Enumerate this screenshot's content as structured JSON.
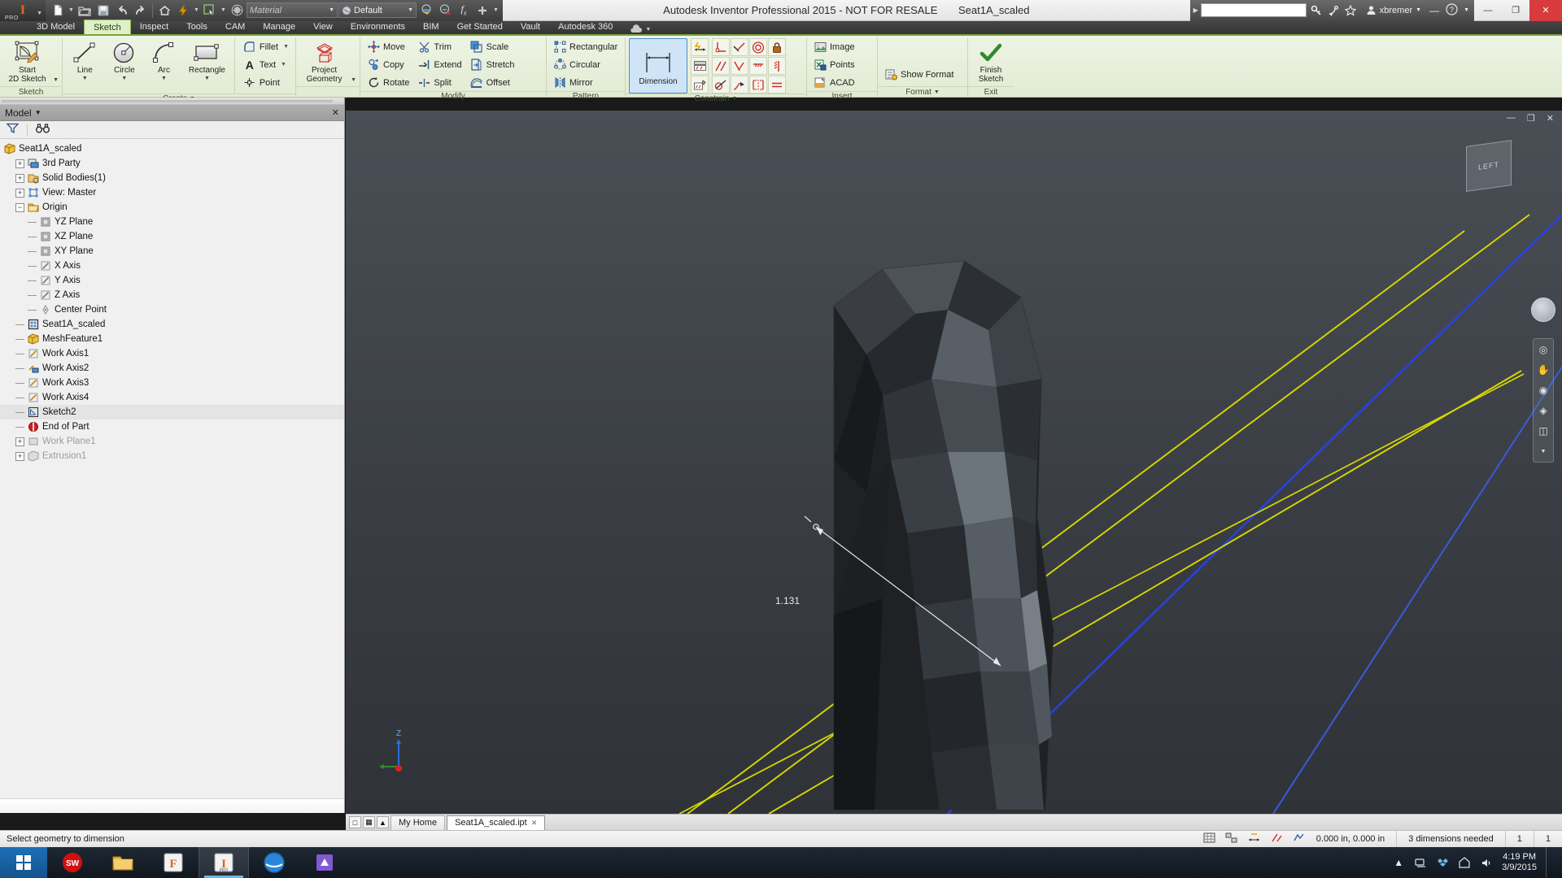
{
  "titlebar": {
    "logo_text": "I",
    "logo_sub": "PRO",
    "material_value": "Material",
    "appearance_value": "Default",
    "app_title": "Autodesk Inventor Professional 2015 - NOT FOR RESALE",
    "file_name": "Seat1A_scaled",
    "search_placeholder": "",
    "search_value": "",
    "user_name": "xbremer",
    "minimize": "—",
    "maximize": "❐",
    "close": "✕",
    "quick_access": [
      {
        "name": "new-file-icon",
        "label": "New"
      },
      {
        "name": "open-file-icon",
        "label": "Open"
      },
      {
        "name": "save-icon",
        "label": "Save"
      },
      {
        "name": "undo-icon",
        "label": "Undo"
      },
      {
        "name": "redo-icon",
        "label": "Redo"
      },
      {
        "name": "home-icon",
        "label": "Home"
      },
      {
        "name": "update-icon",
        "label": "Update"
      },
      {
        "name": "select-icon",
        "label": "Select"
      },
      {
        "name": "appearance-globe-icon",
        "label": "Appearance"
      }
    ],
    "search_icons": [
      {
        "name": "key-icon"
      },
      {
        "name": "satellite-icon"
      },
      {
        "name": "star-icon"
      }
    ],
    "user_icons": [
      {
        "name": "minimize-icon"
      },
      {
        "name": "help-icon"
      }
    ]
  },
  "tabs": [
    {
      "label": "3D Model",
      "active": false
    },
    {
      "label": "Sketch",
      "active": true
    },
    {
      "label": "Inspect",
      "active": false
    },
    {
      "label": "Tools",
      "active": false
    },
    {
      "label": "CAM",
      "active": false
    },
    {
      "label": "Manage",
      "active": false
    },
    {
      "label": "View",
      "active": false
    },
    {
      "label": "Environments",
      "active": false
    },
    {
      "label": "BIM",
      "active": false
    },
    {
      "label": "Get Started",
      "active": false
    },
    {
      "label": "Vault",
      "active": false
    },
    {
      "label": "Autodesk 360",
      "active": false
    }
  ],
  "ribbon": {
    "panels": [
      {
        "label": "Sketch",
        "big": [
          {
            "label": "Start\n2D Sketch",
            "icon": "start-2d-sketch-icon",
            "dropdown": true
          }
        ]
      },
      {
        "label": "Create",
        "label_dropdown": true,
        "big": [
          {
            "label": "Line",
            "icon": "line-icon",
            "dropdown": true
          },
          {
            "label": "Circle",
            "icon": "circle-icon",
            "dropdown": true
          },
          {
            "label": "Arc",
            "icon": "arc-icon",
            "dropdown": true
          },
          {
            "label": "Rectangle",
            "icon": "rectangle-icon",
            "dropdown": true
          }
        ],
        "small": [
          {
            "label": "Fillet",
            "icon": "fillet-icon",
            "dropdown": true
          },
          {
            "label": "Text",
            "icon": "text-icon",
            "dropdown": true
          },
          {
            "label": "Point",
            "icon": "point-icon",
            "dropdown": false
          }
        ]
      },
      {
        "label": "",
        "big": [
          {
            "label": "Project\nGeometry",
            "icon": "project-geometry-icon",
            "dropdown": true
          }
        ]
      },
      {
        "label": "Modify",
        "small_cols": [
          [
            {
              "label": "Move",
              "icon": "move-icon"
            },
            {
              "label": "Copy",
              "icon": "copy-icon"
            },
            {
              "label": "Rotate",
              "icon": "rotate-icon"
            }
          ],
          [
            {
              "label": "Trim",
              "icon": "trim-icon"
            },
            {
              "label": "Extend",
              "icon": "extend-icon"
            },
            {
              "label": "Split",
              "icon": "split-icon"
            }
          ],
          [
            {
              "label": "Scale",
              "icon": "scale-icon"
            },
            {
              "label": "Stretch",
              "icon": "stretch-icon"
            },
            {
              "label": "Offset",
              "icon": "offset-icon"
            }
          ]
        ]
      },
      {
        "label": "Pattern",
        "small_cols": [
          [
            {
              "label": "Rectangular",
              "icon": "rectangular-pattern-icon"
            },
            {
              "label": "Circular",
              "icon": "circular-pattern-icon"
            },
            {
              "label": "Mirror",
              "icon": "mirror-icon"
            }
          ]
        ]
      },
      {
        "label": "Constrain",
        "label_dropdown": true,
        "big": [
          {
            "label": "Dimension",
            "icon": "dimension-icon",
            "selected": true
          }
        ],
        "icon_grid_small": [
          {
            "name": "dimension-auto-icon"
          },
          {
            "name": "show-constraints-icon"
          },
          {
            "name": "constraint-settings-icon"
          }
        ],
        "icon_grid": [
          {
            "name": "coincident-constraint-icon"
          },
          {
            "name": "collinear-constraint-icon"
          },
          {
            "name": "concentric-constraint-icon"
          },
          {
            "name": "fix-constraint-icon"
          },
          {
            "name": "parallel-constraint-icon"
          },
          {
            "name": "perpendicular-constraint-icon"
          },
          {
            "name": "horizontal-constraint-icon"
          },
          {
            "name": "vertical-constraint-icon"
          },
          {
            "name": "tangent-constraint-icon"
          },
          {
            "name": "smooth-constraint-icon"
          },
          {
            "name": "symmetric-constraint-icon"
          },
          {
            "name": "equal-constraint-icon"
          }
        ]
      },
      {
        "label": "Insert",
        "small_cols": [
          [
            {
              "label": "Image",
              "icon": "image-icon"
            },
            {
              "label": "Points",
              "icon": "points-excel-icon"
            },
            {
              "label": "ACAD",
              "icon": "acad-icon"
            }
          ]
        ]
      },
      {
        "label": "Format",
        "label_dropdown": true,
        "small_cols": [
          [
            {
              "label": "Show Format",
              "icon": "show-format-icon"
            }
          ]
        ]
      },
      {
        "label": "Exit",
        "big": [
          {
            "label": "Finish\nSketch",
            "icon": "finish-sketch-icon"
          }
        ]
      }
    ]
  },
  "browser": {
    "panel_title": "Model",
    "filter_icon": "filter-icon",
    "find_icon": "binoculars-icon",
    "close_icon": "close-icon",
    "tree": [
      {
        "label": "Seat1A_scaled",
        "depth": 0,
        "expander": "none",
        "icon": "part-icon",
        "selected": false
      },
      {
        "label": "3rd Party",
        "depth": 1,
        "expander": "plus",
        "icon": "third-party-icon"
      },
      {
        "label": "Solid Bodies(1)",
        "depth": 1,
        "expander": "plus",
        "icon": "solid-bodies-icon"
      },
      {
        "label": "View: Master",
        "depth": 1,
        "expander": "plus",
        "icon": "view-master-icon"
      },
      {
        "label": "Origin",
        "depth": 1,
        "expander": "minus",
        "icon": "folder-icon"
      },
      {
        "label": "YZ Plane",
        "depth": 2,
        "expander": "nub",
        "icon": "plane-icon"
      },
      {
        "label": "XZ Plane",
        "depth": 2,
        "expander": "nub",
        "icon": "plane-icon"
      },
      {
        "label": "XY Plane",
        "depth": 2,
        "expander": "nub",
        "icon": "plane-icon"
      },
      {
        "label": "X Axis",
        "depth": 2,
        "expander": "nub",
        "icon": "axis-icon"
      },
      {
        "label": "Y Axis",
        "depth": 2,
        "expander": "nub",
        "icon": "axis-icon"
      },
      {
        "label": "Z Axis",
        "depth": 2,
        "expander": "nub",
        "icon": "axis-icon"
      },
      {
        "label": "Center Point",
        "depth": 2,
        "expander": "nub",
        "icon": "center-point-icon"
      },
      {
        "label": "Seat1A_scaled",
        "depth": 1,
        "expander": "nub",
        "icon": "mesh-icon"
      },
      {
        "label": "MeshFeature1",
        "depth": 1,
        "expander": "nub",
        "icon": "part-icon"
      },
      {
        "label": "Work Axis1",
        "depth": 1,
        "expander": "nub",
        "icon": "work-axis-icon"
      },
      {
        "label": "Work Axis2",
        "depth": 1,
        "expander": "nub",
        "icon": "work-axis-2-icon"
      },
      {
        "label": "Work Axis3",
        "depth": 1,
        "expander": "nub",
        "icon": "work-axis-icon"
      },
      {
        "label": "Work Axis4",
        "depth": 1,
        "expander": "nub",
        "icon": "work-axis-icon"
      },
      {
        "label": "Sketch2",
        "depth": 1,
        "expander": "nub",
        "icon": "sketch-icon",
        "selected": true
      },
      {
        "label": "End of Part",
        "depth": 1,
        "expander": "nub",
        "icon": "end-of-part-icon"
      },
      {
        "label": "Work Plane1",
        "depth": 1,
        "expander": "plus",
        "icon": "work-plane-icon",
        "dim": true
      },
      {
        "label": "Extrusion1",
        "depth": 1,
        "expander": "plus",
        "icon": "extrusion-icon",
        "dim": true
      }
    ]
  },
  "viewport": {
    "viewcube_label": "LEFT",
    "dimension_value": "1.131",
    "axis_labels": {
      "z": "Z",
      "x": "",
      "y": ""
    },
    "window_buttons": [
      "—",
      "❐",
      "✕"
    ],
    "nav_icons": [
      {
        "name": "orbit-icon"
      },
      {
        "name": "pan-hand-icon"
      },
      {
        "name": "zoom-icon"
      },
      {
        "name": "look-at-icon"
      },
      {
        "name": "display-style-icon"
      }
    ]
  },
  "doctabs": {
    "left_icons": [
      {
        "name": "single-view-icon"
      },
      {
        "name": "tile-view-icon"
      }
    ],
    "tabs": [
      {
        "label": "My Home",
        "active": false,
        "closable": false
      },
      {
        "label": "Seat1A_scaled.ipt",
        "active": true,
        "closable": true
      }
    ]
  },
  "statusbar": {
    "message": "Select geometry to dimension",
    "coordinates": "0.000 in, 0.000 in",
    "dimension_status": "3 dimensions needed",
    "cell_1": "1",
    "cell_2": "1",
    "icons": [
      {
        "name": "grid-icon"
      },
      {
        "name": "snap-icon"
      },
      {
        "name": "dimension-display-icon"
      },
      {
        "name": "constraint-display-icon"
      },
      {
        "name": "relax-mode-icon"
      }
    ]
  },
  "taskbar": {
    "start_label": "⊞",
    "items": [
      {
        "name": "solidworks-icon",
        "label": "SW",
        "running": false
      },
      {
        "name": "explorer-icon",
        "label": "",
        "running": false
      },
      {
        "name": "fusion-icon",
        "label": "F",
        "running": false
      },
      {
        "name": "inventor-icon",
        "label": "I",
        "running": true,
        "active": true
      },
      {
        "name": "browser-icon",
        "label": "",
        "running": false
      },
      {
        "name": "other-app-icon",
        "label": "",
        "running": false
      }
    ],
    "tray": [
      {
        "name": "show-hidden-icons-icon"
      },
      {
        "name": "network-icon"
      },
      {
        "name": "dropbox-icon"
      },
      {
        "name": "action-center-icon"
      },
      {
        "name": "volume-icon"
      }
    ],
    "clock_time": "4:19 PM",
    "clock_date": "3/9/2015"
  },
  "colors": {
    "accent_green": "#7aa13c",
    "tab_active_bg": "#dff0c8",
    "selected_blue": "#cfe4f7",
    "viewport_bg": "#3c4046",
    "dim_line": "#e8e8e8",
    "sketch_blue": "#2a4be0",
    "projected_yellow": "#d8d800",
    "taskbar_bg": "#17202a"
  }
}
